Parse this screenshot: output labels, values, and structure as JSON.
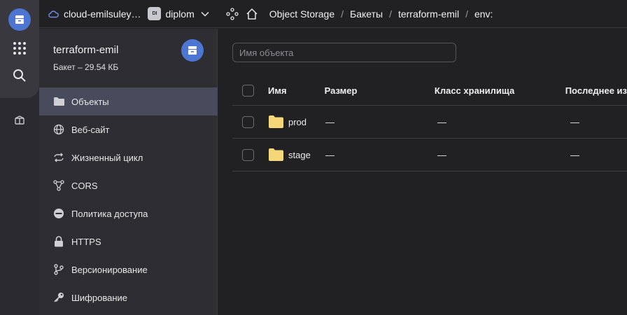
{
  "header": {
    "cloud_name": "cloud-emilsuley…",
    "folder_badge": "DI",
    "folder_name": "diplom",
    "breadcrumb": [
      "Object Storage",
      "Бакеты",
      "terraform-emil",
      "env:"
    ]
  },
  "bucket": {
    "name": "terraform-emil",
    "summary": "Бакет – 29.54 КБ"
  },
  "sidebar": {
    "items": [
      {
        "label": "Объекты",
        "icon": "folder-icon"
      },
      {
        "label": "Веб-сайт",
        "icon": "globe-icon"
      },
      {
        "label": "Жизненный цикл",
        "icon": "cycle-icon"
      },
      {
        "label": "CORS",
        "icon": "cors-icon"
      },
      {
        "label": "Политика доступа",
        "icon": "access-policy-icon"
      },
      {
        "label": "HTTPS",
        "icon": "lock-icon"
      },
      {
        "label": "Версионирование",
        "icon": "versioning-icon"
      },
      {
        "label": "Шифрование",
        "icon": "key-icon"
      }
    ]
  },
  "search": {
    "placeholder": "Имя объекта"
  },
  "table": {
    "columns": [
      "Имя",
      "Размер",
      "Класс хранилища",
      "Последнее из"
    ],
    "rows": [
      {
        "name": "prod",
        "size": "—",
        "class": "—",
        "last": "—"
      },
      {
        "name": "stage",
        "size": "—",
        "class": "—",
        "last": "—"
      }
    ]
  },
  "colors": {
    "accent": "#4d75d2",
    "folder": "#f5d77a",
    "selected": "#474b5c"
  }
}
